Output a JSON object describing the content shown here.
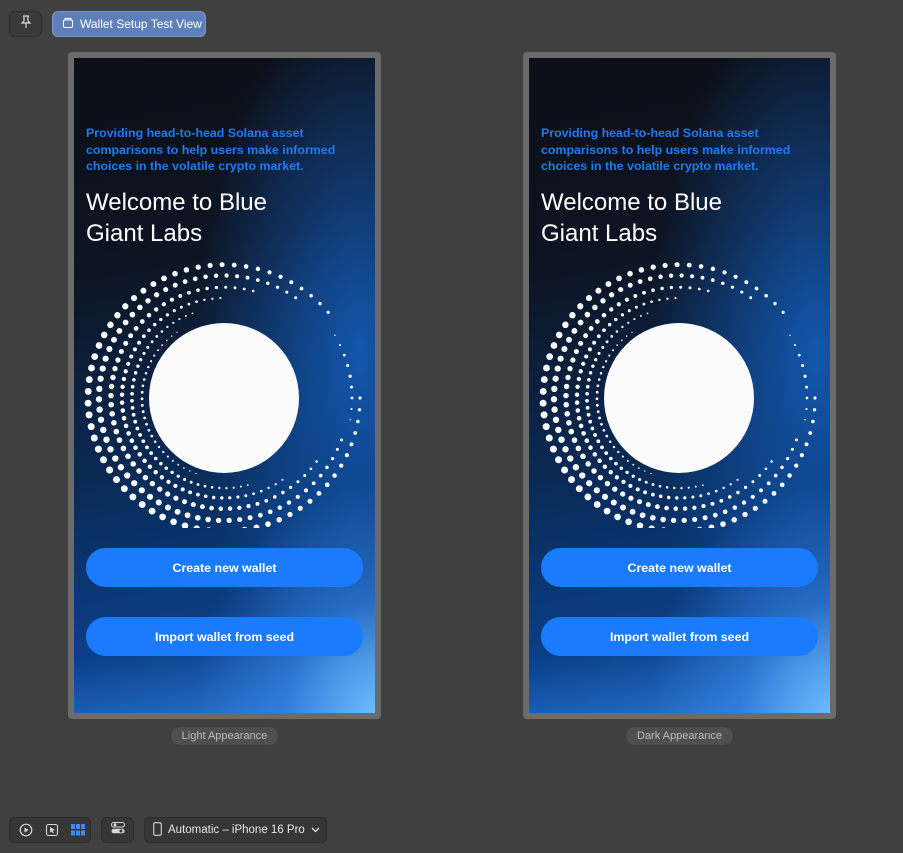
{
  "toolbar": {
    "tab_label": "Wallet Setup Test View"
  },
  "screen": {
    "tagline": "Providing head-to-head Solana asset comparisons to help users make informed choices in the volatile crypto market.",
    "welcome": "Welcome to Blue Giant Labs",
    "create_label": "Create new wallet",
    "import_label": "Import wallet from seed"
  },
  "previews": {
    "light_caption": "Light Appearance",
    "dark_caption": "Dark Appearance"
  },
  "bottom_bar": {
    "device_label": "Automatic – iPhone 16 Pro"
  },
  "colors": {
    "accent": "#1a7bff",
    "tagline": "#1e7cf2",
    "background": "#404040"
  },
  "icons": [
    "pin-icon",
    "preview-icon",
    "play-icon",
    "cursor-icon",
    "grid-icon",
    "toggles-icon",
    "phone-icon",
    "chevron-down-icon"
  ]
}
